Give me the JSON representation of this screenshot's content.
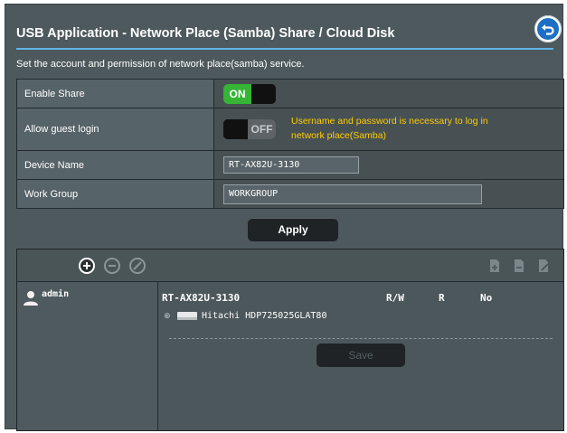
{
  "header": {
    "title": "USB Application - Network Place (Samba) Share / Cloud Disk",
    "back_icon": "back-arrow-icon"
  },
  "description": "Set the account and permission of network place(samba) service.",
  "settings": {
    "enable_share": {
      "label": "Enable Share",
      "state": "ON"
    },
    "allow_guest": {
      "label": "Allow guest login",
      "state": "OFF",
      "hint": "Username and password is necessary to log in network place(Samba)"
    },
    "device_name": {
      "label": "Device Name",
      "value": "RT-AX82U-3130"
    },
    "work_group": {
      "label": "Work Group",
      "value": "WORKGROUP"
    }
  },
  "apply_label": "Apply",
  "share_panel": {
    "toolbar_icons": [
      "add-user-icon",
      "remove-user-icon",
      "edit-user-icon",
      "add-folder-icon",
      "delete-folder-icon",
      "modify-folder-icon"
    ],
    "user": "admin",
    "device": "RT-AX82U-3130",
    "perm_headers": [
      "R/W",
      "R",
      "No"
    ],
    "disk": "Hitachi HDP725025GLAT80",
    "save_label": "Save"
  },
  "colors": {
    "panel_bg": "#4d595d",
    "accent_line": "#60b4e4",
    "switch_on": "#36b435",
    "hint": "#ffcc00",
    "back_button": "#1d6fc6"
  }
}
